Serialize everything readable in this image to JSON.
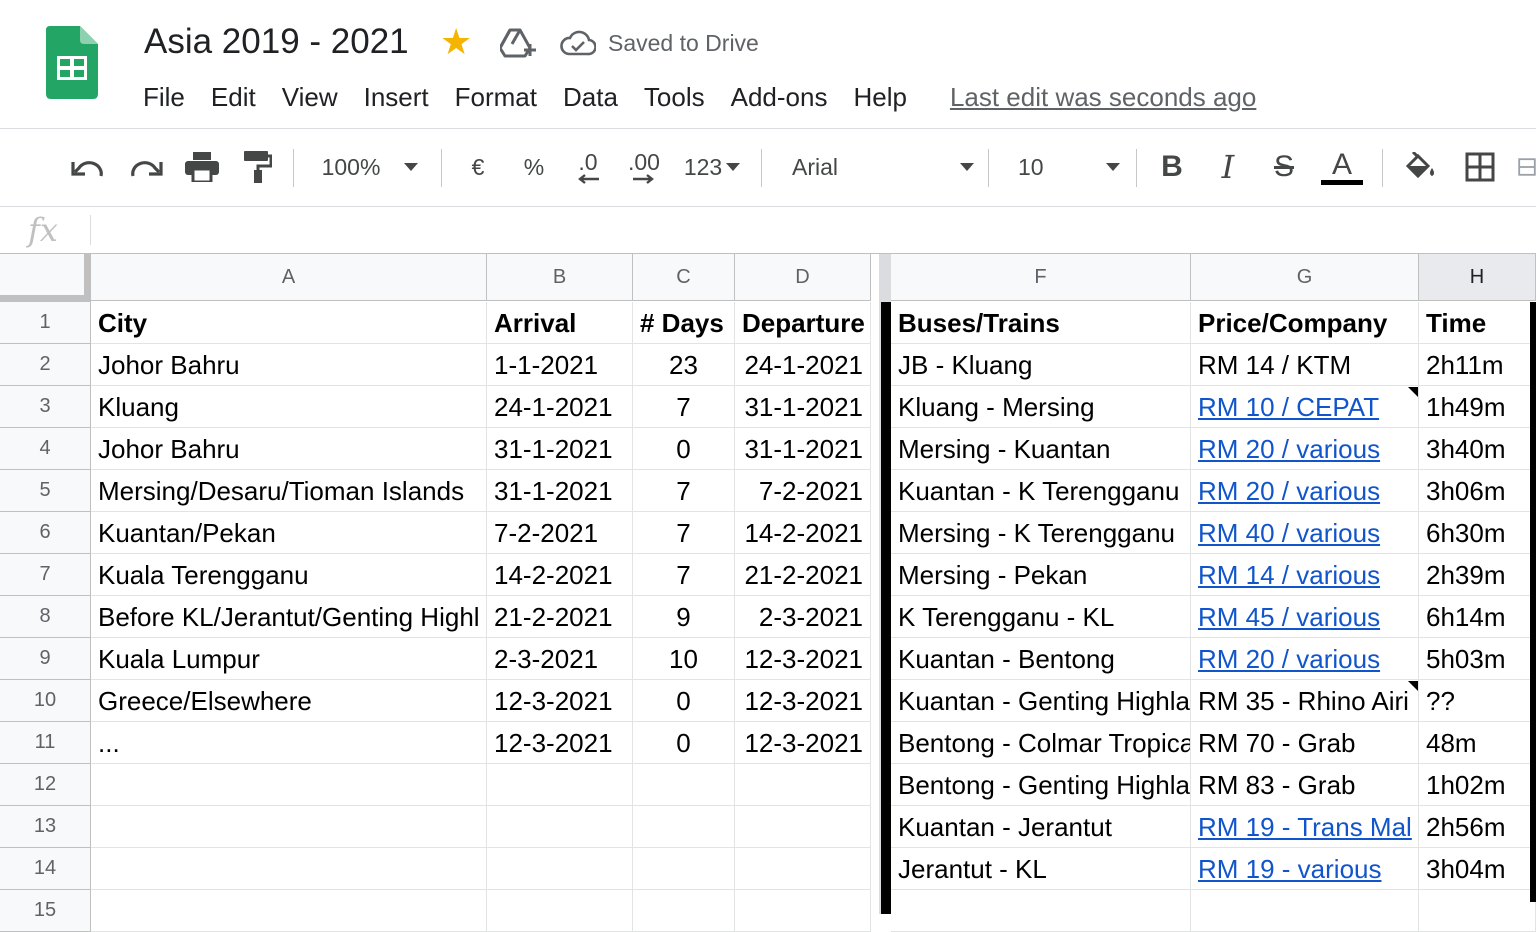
{
  "app": {
    "doc_title": "Asia 2019 - 2021",
    "save_status": "Saved to Drive",
    "last_edit": "Last edit was seconds ago",
    "menu": [
      "File",
      "Edit",
      "View",
      "Insert",
      "Format",
      "Data",
      "Tools",
      "Add-ons",
      "Help"
    ]
  },
  "toolbar": {
    "zoom": "100%",
    "currency": "€",
    "percent": "%",
    "decrease_decimals": ".0",
    "increase_decimals": ".00",
    "more_formats": "123",
    "font": "Arial",
    "font_size": "10",
    "bold": "B",
    "italic": "I",
    "strike": "S",
    "text_color": "A",
    "text_color_swatch": "#000000"
  },
  "formula_bar": {
    "fx": "fx"
  },
  "columns": [
    "A",
    "B",
    "C",
    "D",
    "F",
    "G",
    "H"
  ],
  "rows": [
    "1",
    "2",
    "3",
    "4",
    "5",
    "6",
    "7",
    "8",
    "9",
    "10",
    "11",
    "12",
    "13",
    "14",
    "15"
  ],
  "cells": [
    [
      "City",
      "Arrival",
      "# Days",
      "Departure",
      "Buses/Trains",
      "Price/Company",
      "Time"
    ],
    [
      "Johor Bahru",
      "1-1-2021",
      "23",
      "24-1-2021",
      "JB - Kluang",
      "RM 14 / KTM",
      "2h11m"
    ],
    [
      "Kluang",
      "24-1-2021",
      "7",
      "31-1-2021",
      "Kluang - Mersing",
      "RM 10 / CEPAT",
      "1h49m"
    ],
    [
      "Johor Bahru",
      "31-1-2021",
      "0",
      "31-1-2021",
      "Mersing - Kuantan",
      "RM 20 / various",
      "3h40m"
    ],
    [
      "Mersing/Desaru/Tioman Islands",
      "31-1-2021",
      "7",
      "7-2-2021",
      "Kuantan - K Terengganu",
      "RM 20 / various",
      "3h06m"
    ],
    [
      "Kuantan/Pekan",
      "7-2-2021",
      "7",
      "14-2-2021",
      "Mersing - K Terengganu",
      "RM 40 / various",
      "6h30m"
    ],
    [
      "Kuala Terengganu",
      "14-2-2021",
      "7",
      "21-2-2021",
      "Mersing - Pekan",
      "RM 14 / various",
      "2h39m"
    ],
    [
      "Before KL/Jerantut/Genting Highl",
      "21-2-2021",
      "9",
      "2-3-2021",
      "K Terengganu - KL",
      "RM 45 / various",
      "6h14m"
    ],
    [
      "Kuala Lumpur",
      "2-3-2021",
      "10",
      "12-3-2021",
      "Kuantan - Bentong",
      "RM 20 / various",
      "5h03m"
    ],
    [
      "Greece/Elsewhere",
      "12-3-2021",
      "0",
      "12-3-2021",
      "Kuantan - Genting Highla",
      "RM 35 - Rhino Airi",
      "??"
    ],
    [
      "...",
      "12-3-2021",
      "0",
      "12-3-2021",
      "Bentong - Colmar Tropica",
      "RM 70 - Grab",
      "48m"
    ],
    [
      "",
      "",
      "",
      "",
      "Bentong - Genting Highla",
      "RM 83 - Grab",
      "1h02m"
    ],
    [
      "",
      "",
      "",
      "",
      "Kuantan - Jerantut",
      "RM 19 - Trans Mal",
      "2h56m"
    ],
    [
      "",
      "",
      "",
      "",
      "Jerantut - KL",
      "RM 19 - various",
      "3h04m"
    ],
    [
      "",
      "",
      "",
      "",
      "",
      "",
      ""
    ]
  ],
  "links": [
    [
      false,
      false,
      false,
      false,
      false,
      false,
      false
    ],
    [
      false,
      false,
      false,
      false,
      false,
      false,
      false
    ],
    [
      false,
      false,
      false,
      false,
      false,
      true,
      false
    ],
    [
      false,
      false,
      false,
      false,
      false,
      true,
      false
    ],
    [
      false,
      false,
      false,
      false,
      false,
      true,
      false
    ],
    [
      false,
      false,
      false,
      false,
      false,
      true,
      false
    ],
    [
      false,
      false,
      false,
      false,
      false,
      true,
      false
    ],
    [
      false,
      false,
      false,
      false,
      false,
      true,
      false
    ],
    [
      false,
      false,
      false,
      false,
      false,
      true,
      false
    ],
    [
      false,
      false,
      false,
      false,
      false,
      false,
      false
    ],
    [
      false,
      false,
      false,
      false,
      false,
      false,
      false
    ],
    [
      false,
      false,
      false,
      false,
      false,
      false,
      false
    ],
    [
      false,
      false,
      false,
      false,
      false,
      true,
      false
    ],
    [
      false,
      false,
      false,
      false,
      false,
      true,
      false
    ],
    [
      false,
      false,
      false,
      false,
      false,
      false,
      false
    ]
  ],
  "colors": {
    "link": "#1155cc",
    "sheets_green": "#0f9d58",
    "star": "#f4b400"
  }
}
